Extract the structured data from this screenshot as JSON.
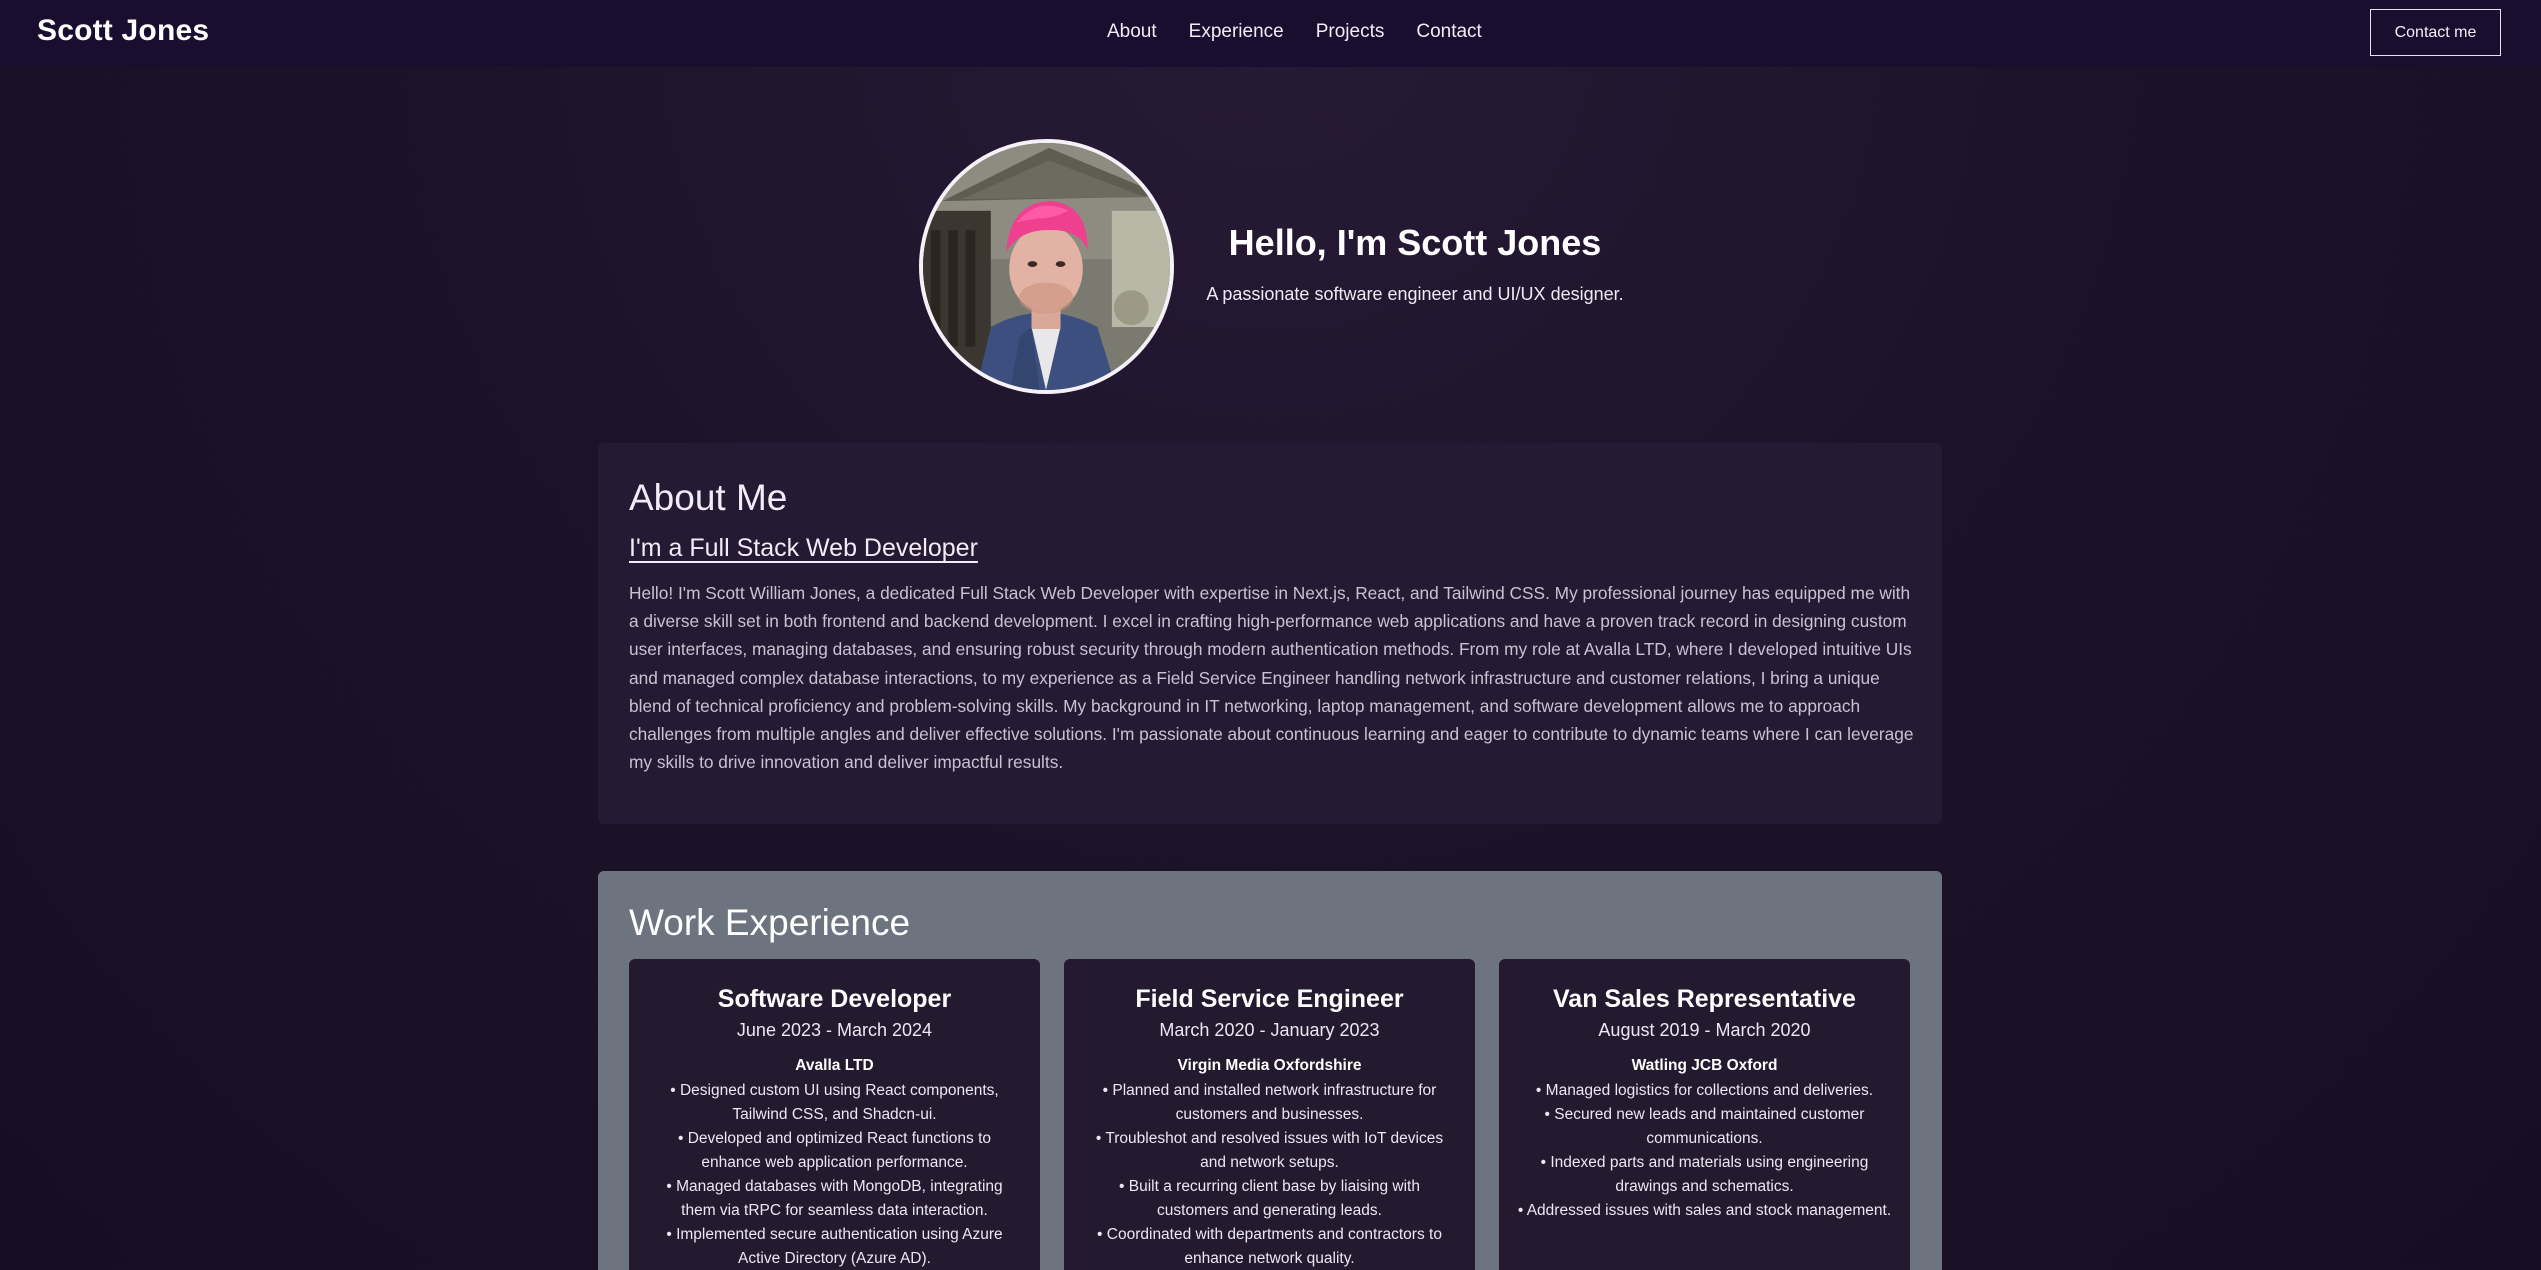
{
  "nav": {
    "brand": "Scott Jones",
    "links": [
      "About",
      "Experience",
      "Projects",
      "Contact"
    ],
    "contact_button": "Contact me"
  },
  "hero": {
    "title": "Hello, I'm Scott Jones",
    "subtitle": "A passionate software engineer and UI/UX designer."
  },
  "about": {
    "heading": "About Me",
    "subheading": "I'm a Full Stack Web Developer",
    "body": "Hello! I'm Scott William Jones, a dedicated Full Stack Web Developer with expertise in Next.js, React, and Tailwind CSS. My professional journey has equipped me with a diverse skill set in both frontend and backend development. I excel in crafting high-performance web applications and have a proven track record in designing custom user interfaces, managing databases, and ensuring robust security through modern authentication methods. From my role at Avalla LTD, where I developed intuitive UIs and managed complex database interactions, to my experience as a Field Service Engineer handling network infrastructure and customer relations, I bring a unique blend of technical proficiency and problem-solving skills. My background in IT networking, laptop management, and software development allows me to approach challenges from multiple angles and deliver effective solutions. I'm passionate about continuous learning and eager to contribute to dynamic teams where I can leverage my skills to drive innovation and deliver impactful results."
  },
  "work": {
    "heading": "Work Experience",
    "jobs": [
      {
        "title": "Software Developer",
        "dates": "June 2023 - March 2024",
        "company": "Avalla LTD",
        "bullets": [
          "Designed custom UI using React components, Tailwind CSS, and Shadcn-ui.",
          "Developed and optimized React functions to enhance web application performance.",
          "Managed databases with MongoDB, integrating them via tRPC for seamless data interaction.",
          "Implemented secure authentication using Azure Active Directory (Azure AD)."
        ]
      },
      {
        "title": "Field Service Engineer",
        "dates": "March 2020 - January 2023",
        "company": "Virgin Media Oxfordshire",
        "bullets": [
          "Planned and installed network infrastructure for customers and businesses.",
          "Troubleshot and resolved issues with IoT devices and network setups.",
          "Built a recurring client base by liaising with customers and generating leads.",
          "Coordinated with departments and contractors to enhance network quality."
        ]
      },
      {
        "title": "Van Sales Representative",
        "dates": "August 2019 - March 2020",
        "company": "Watling JCB Oxford",
        "bullets": [
          "Managed logistics for collections and deliveries.",
          "Secured new leads and maintained customer communications.",
          "Indexed parts and materials using engineering drawings and schematics.",
          "Addressed issues with sales and stock management."
        ]
      }
    ]
  }
}
